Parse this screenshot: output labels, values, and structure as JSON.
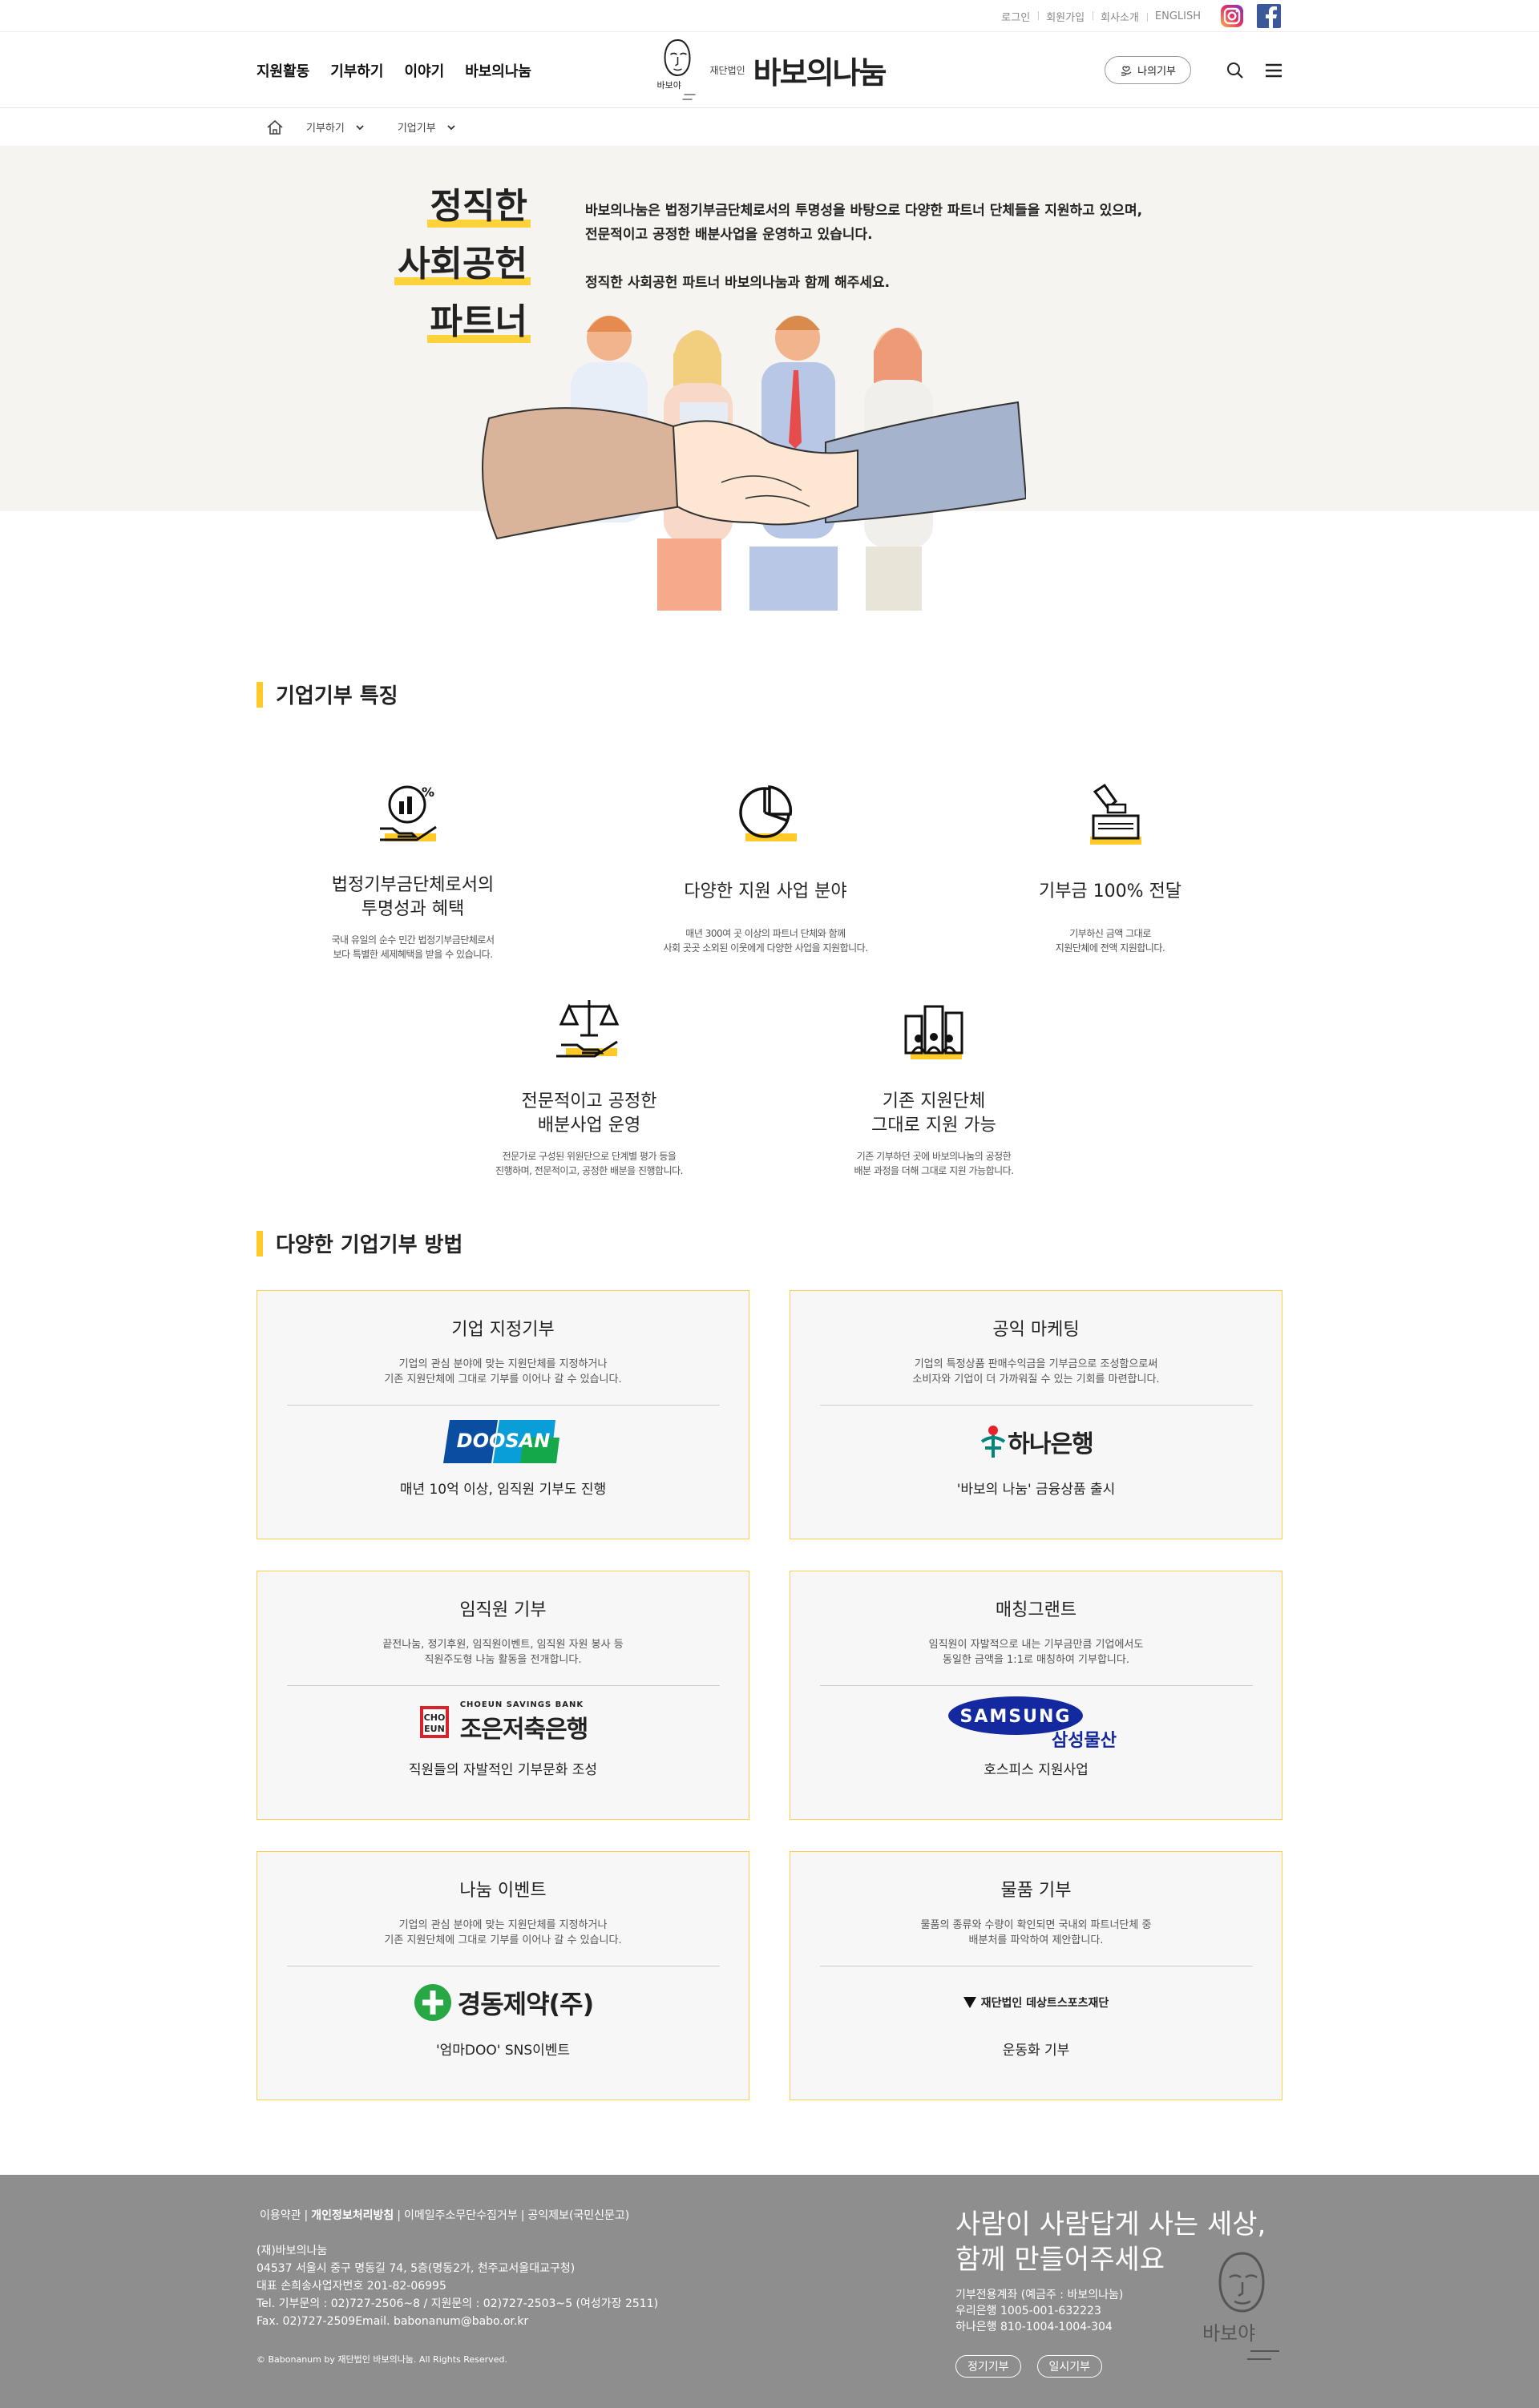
{
  "util": {
    "links": [
      "로그인",
      "회원가입",
      "회사소개",
      "ENGLISH"
    ]
  },
  "header": {
    "nav": [
      "지원활동",
      "기부하기",
      "이야기",
      "바보의나눔"
    ],
    "logo_corp": "재단법인",
    "logo_name": "바보의나눔",
    "logo_sign": "바보야",
    "my_donation": "나의기부"
  },
  "breadcrumb": [
    "기부하기",
    "기업기부"
  ],
  "hero": {
    "title_lines": [
      "정직한",
      "사회공헌",
      "파트너"
    ],
    "desc_1": "바보의나눔은 법정기부금단체로서의 투명성을 바탕으로 다양한 파트너 단체들을 지원하고 있으며,",
    "desc_2": "전문적이고 공정한 배분사업을 운영하고 있습니다.",
    "desc_3": "정직한 사회공헌 파트너 바보의나눔과 함께 해주세요."
  },
  "features_section": {
    "title": "기업기부 특징",
    "items": [
      {
        "icon": "chart-hand-icon",
        "title_1": "법정기부금단체로서의",
        "title_2": "투명성과 혜택",
        "desc_1": "국내 유일의 순수 민간 법정기부금단체로서",
        "desc_2": "보다 특별한 세제혜택을 받을 수 있습니다."
      },
      {
        "icon": "pie-chart-icon",
        "title_1": "다양한 지원 사업 분야",
        "title_2": "",
        "desc_1": "매년 300여 곳 이상의 파트너 단체와 함께",
        "desc_2": "사회 곳곳 소외된 이웃에게 다양한 사업을 지원합니다."
      },
      {
        "icon": "donation-box-icon",
        "title_1": "기부금 100% 전달",
        "title_2": "",
        "desc_1": "기부하신 금액 그대로",
        "desc_2": "지원단체에 전액 지원합니다."
      },
      {
        "icon": "scale-hand-icon",
        "title_1": "전문적이고 공정한",
        "title_2": "배분사업 운영",
        "desc_1": "전문가로 구성된 위원단으로 단계별 평가 등을",
        "desc_2": "진행하며, 전문적이고, 공정한 배분을 진행합니다."
      },
      {
        "icon": "buildings-people-icon",
        "title_1": "기존 지원단체",
        "title_2": "그대로 지원 가능",
        "desc_1": "기존 기부하던 곳에 바보의나눔의 공정한",
        "desc_2": "배분 과정을 더해 그대로 지원 가능합니다."
      }
    ]
  },
  "methods_section": {
    "title": "다양한 기업기부 방법",
    "cards": [
      {
        "title": "기업 지정기부",
        "desc_1": "기업의 관심 분야에 맞는 지원단체를 지정하거나",
        "desc_2": "기존 지원단체에 그대로 기부를 이어나 갈 수 있습니다.",
        "logo": "DOOSAN",
        "sub": "매년 10억 이상, 임직원 기부도 진행"
      },
      {
        "title": "공익 마케팅",
        "desc_1": "기업의 특정상품 판매수익금을 기부금으로 조성함으로써",
        "desc_2": "소비자와 기업이 더 가까워질 수 있는 기회를 마련합니다.",
        "logo": "하나은행",
        "sub": "'바보의 나눔' 금융상품 출시"
      },
      {
        "title": "임직원 기부",
        "desc_1": "끝전나눔, 정기후원, 임직원이벤트, 임직원 자원 봉사 등",
        "desc_2": "직원주도형 나눔 활동을 전개합니다.",
        "logo": "조은저축은행",
        "logo_small": "CHOEUN SAVINGS BANK",
        "logo_mark": "CHO EUN",
        "sub": "직원들의 자발적인 기부문화 조성"
      },
      {
        "title": "매칭그랜트",
        "desc_1": "임직원이 자발적으로 내는 기부금만큼 기업에서도",
        "desc_2": "동일한 금액을 1:1로 매칭하여 기부합니다.",
        "logo": "SAMSUNG",
        "logo_small": "삼성물산",
        "sub": "호스피스 지원사업"
      },
      {
        "title": "나눔 이벤트",
        "desc_1": "기업의 관심 분야에 맞는 지원단체를 지정하거나",
        "desc_2": "기존 지원단체에 그대로 기부를 이어나 갈 수 있습니다.",
        "logo": "경동제약(주)",
        "sub": "'엄마DOO' SNS이벤트"
      },
      {
        "title": "물품 기부",
        "desc_1": "물품의 종류와 수량이 확인되면 국내외 파트너단체 중",
        "desc_2": "배분처를 파악하여 제안합니다.",
        "logo": "재단법인 데상트스포츠재단",
        "sub": "운동화 기부"
      }
    ]
  },
  "footer": {
    "links": [
      "이용약관",
      "개인정보처리방침",
      "이메일주소무단수집거부",
      "공익제보(국민신문고)"
    ],
    "org": "(재)바보의나눔",
    "address": "04537 서울시 중구 명동길 74, 5층(명동2가, 천주교서울대교구청)",
    "biz": "대표 손희송사업자번호 201-82-06995",
    "tel": "Tel. 기부문의 : 02)727-2506~8 / 지원문의 : 02)727-2503~5 (여성가장 2511)",
    "fax": "Fax. 02)727-2509Email. babonanum@babo.or.kr",
    "copyright": "© Babonanum by 재단법인 바보의나눔. All Rights Reserved.",
    "slogan_1": "사람이 사람답게 사는 세상,",
    "slogan_2": "함께 만들어주세요",
    "acct_1": "기부전용계좌 (예금주 : 바보의나눔)",
    "acct_2": "우리은행 1005-001-632223",
    "acct_3": "하나은행 810-1004-1004-304",
    "btn_regular": "정기기부",
    "btn_once": "일시기부",
    "sign": "바보야"
  },
  "colors": {
    "accent": "#ffc928",
    "hero_bg": "#f5f4f0",
    "footer_bg": "#8e8e8e",
    "card_border": "#ffce4a"
  }
}
